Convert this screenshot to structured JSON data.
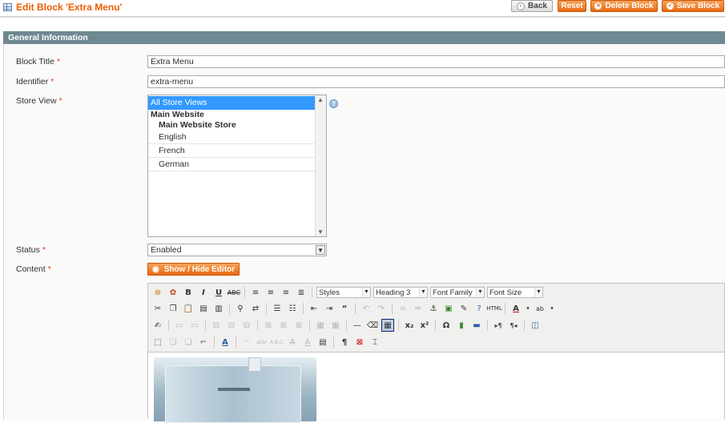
{
  "header": {
    "title": "Edit Block 'Extra Menu'",
    "back_label": "Back",
    "reset_label": "Reset",
    "delete_label": "Delete Block",
    "save_label": "Save Block"
  },
  "section": {
    "title": "General Information"
  },
  "form": {
    "block_title": {
      "label": "Block Title",
      "value": "Extra Menu"
    },
    "identifier": {
      "label": "Identifier",
      "value": "extra-menu"
    },
    "store_view": {
      "label": "Store View",
      "options": {
        "all": "All Store Views",
        "website": "Main Website",
        "store": "Main Website Store",
        "english": "English",
        "french": "French",
        "german": "German"
      }
    },
    "status": {
      "label": "Status",
      "value": "Enabled"
    },
    "content": {
      "label": "Content",
      "toggle_label": "Show / Hide Editor"
    },
    "required_mark": "*"
  },
  "editor": {
    "styles_label": "Styles",
    "heading_label": "Heading 3",
    "font_family_label": "Font Family",
    "font_size_label": "Font Size"
  },
  "colors": {
    "accent_orange": "#eb5e00",
    "section_bar": "#6f8992",
    "selected_option": "#3399ff"
  }
}
